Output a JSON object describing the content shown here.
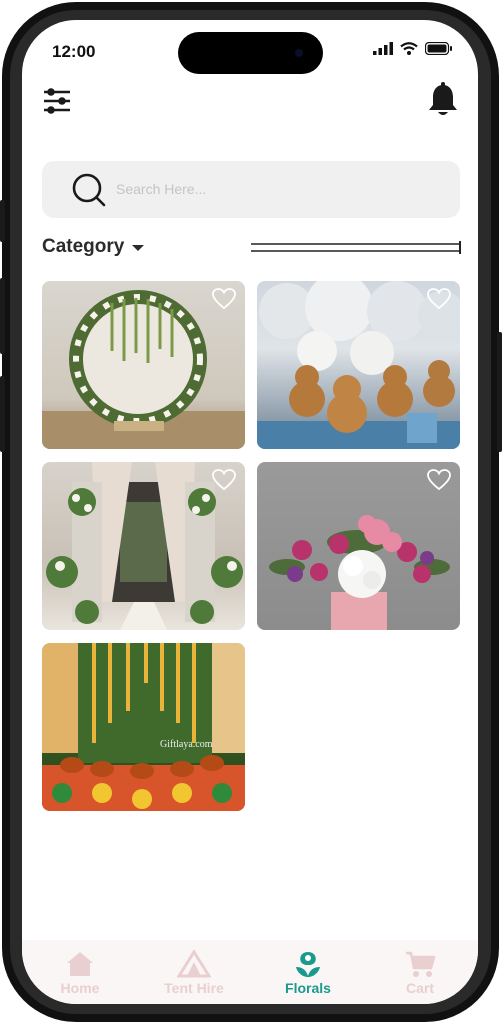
{
  "status": {
    "time": "12:00"
  },
  "search": {
    "placeholder": "Search Here..."
  },
  "category": {
    "label": "Category"
  },
  "cards": [
    {
      "name": "floral-arch",
      "liked": false
    },
    {
      "name": "teddy-balloons",
      "liked": false
    },
    {
      "name": "wedding-aisle",
      "liked": false
    },
    {
      "name": "flower-bouquet",
      "liked": false
    },
    {
      "name": "traditional-decor",
      "liked": false,
      "watermark": "Giftlaya.com"
    }
  ],
  "nav": {
    "home": "Home",
    "tent_hire": "Tent Hire",
    "florals": "Florals",
    "cart": "Cart",
    "active": "florals"
  },
  "colors": {
    "accent": "#1a9a8c",
    "inactive_nav": "#e9cfcf",
    "search_bg": "#f0f0f0"
  }
}
